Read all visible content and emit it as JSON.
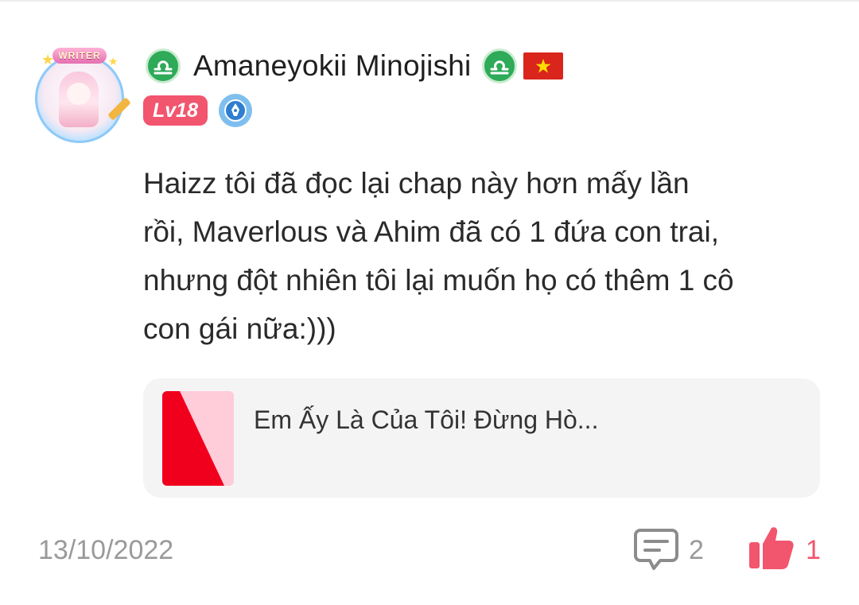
{
  "avatar": {
    "banner_text": "WRITER",
    "icon": "writer-avatar-icon"
  },
  "user": {
    "zodiac_icon": "libra-icon",
    "zodiac_color": "#2eaa58",
    "name": "Amaneyokii Minojishi",
    "flag_icon": "vietnam-flag-icon",
    "level": "Lv18",
    "level_color": "#f2556e",
    "extra_badge_icon": "pen-nib-badge-icon"
  },
  "comment": {
    "text": "Haizz tôi đã đọc lại chap này hơn mấy lần\nrồi, Maverlous và Ahim đã có 1 đứa con trai,\nnhưng đột nhiên tôi lại muốn họ có thêm 1 cô\ncon gái nữa:)))"
  },
  "linked_story": {
    "title": "Em Ấy Là Của Tôi! Đừng Hò...",
    "thumbnail_colors": [
      "#f0001d",
      "#ffccd9"
    ]
  },
  "footer": {
    "date": "13/10/2022",
    "reply_icon": "comment-icon",
    "reply_count": "2",
    "like_icon": "thumbs-up-icon",
    "like_count": "1",
    "like_color": "#f2556e"
  }
}
